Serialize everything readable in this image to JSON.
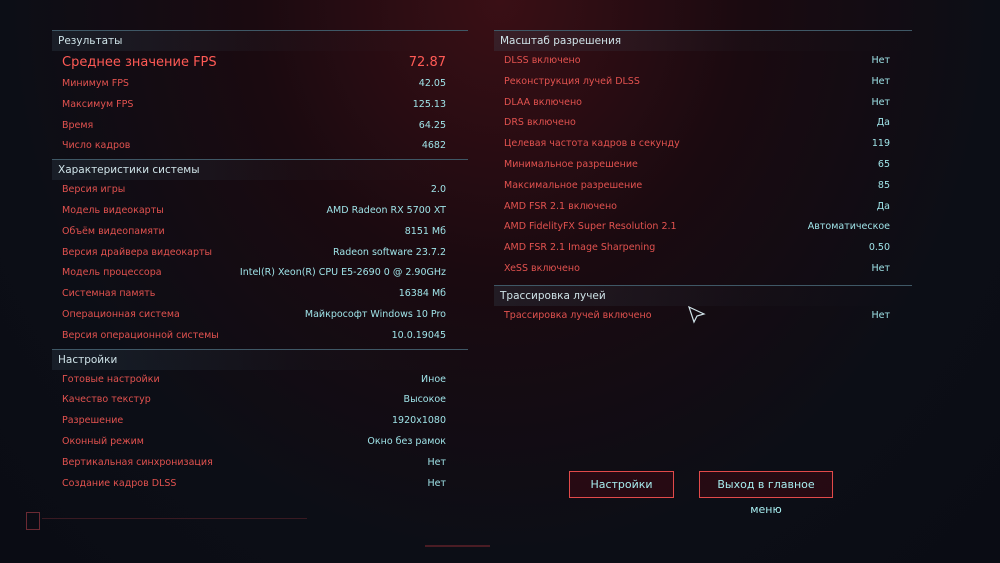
{
  "results": {
    "header": "Результаты",
    "avg_fps_label": "Среднее значение FPS",
    "avg_fps_value": "72.87",
    "rows": [
      {
        "label": "Минимум FPS",
        "value": "42.05"
      },
      {
        "label": "Максимум FPS",
        "value": "125.13"
      },
      {
        "label": "Время",
        "value": "64.25"
      },
      {
        "label": "Число кадров",
        "value": "4682"
      }
    ]
  },
  "system": {
    "header": "Характеристики системы",
    "rows": [
      {
        "label": "Версия игры",
        "value": "2.0"
      },
      {
        "label": "Модель видеокарты",
        "value": "AMD Radeon RX 5700 XT"
      },
      {
        "label": "Объём видеопамяти",
        "value": "8151 Мб"
      },
      {
        "label": "Версия драйвера видеокарты",
        "value": "Radeon software 23.7.2"
      },
      {
        "label": "Модель процессора",
        "value": "Intel(R) Xeon(R) CPU E5-2690 0 @ 2.90GHz"
      },
      {
        "label": "Системная память",
        "value": "16384 Мб"
      },
      {
        "label": "Операционная система",
        "value": "Майкрософт Windows 10 Pro"
      },
      {
        "label": "Версия операционной системы",
        "value": "10.0.19045"
      }
    ]
  },
  "settings": {
    "header": "Настройки",
    "rows": [
      {
        "label": "Готовые настройки",
        "value": "Иное"
      },
      {
        "label": "Качество текстур",
        "value": "Высокое"
      },
      {
        "label": "Разрешение",
        "value": "1920x1080"
      },
      {
        "label": "Оконный режим",
        "value": "Окно без рамок"
      },
      {
        "label": "Вертикальная синхронизация",
        "value": "Нет"
      },
      {
        "label": "Создание кадров DLSS",
        "value": "Нет"
      }
    ]
  },
  "scaling": {
    "header": "Масштаб разрешения",
    "rows": [
      {
        "label": "DLSS включено",
        "value": "Нет"
      },
      {
        "label": "Реконструкция лучей DLSS",
        "value": "Нет"
      },
      {
        "label": "DLAA включено",
        "value": "Нет"
      },
      {
        "label": "DRS включено",
        "value": "Да"
      },
      {
        "label": "Целевая частота кадров в секунду",
        "value": "119"
      },
      {
        "label": "Минимальное разрешение",
        "value": "65"
      },
      {
        "label": "Максимальное разрешение",
        "value": "85"
      },
      {
        "label": "AMD FSR 2.1 включено",
        "value": "Да"
      },
      {
        "label": "AMD FidelityFX Super Resolution 2.1",
        "value": "Автоматическое"
      },
      {
        "label": "AMD FSR 2.1 Image Sharpening",
        "value": "0.50"
      },
      {
        "label": "XeSS включено",
        "value": "Нет"
      }
    ]
  },
  "raytracing": {
    "header": "Трассировка лучей",
    "rows": [
      {
        "label": "Трассировка лучей включено",
        "value": "Нет"
      }
    ]
  },
  "buttons": {
    "settings": "Настройки",
    "exit": "Выход в главное меню"
  },
  "colors": {
    "label": "#e2524f",
    "value": "#9fe3e8",
    "accent": "#ff5a55",
    "button_border": "#e24a4a"
  }
}
